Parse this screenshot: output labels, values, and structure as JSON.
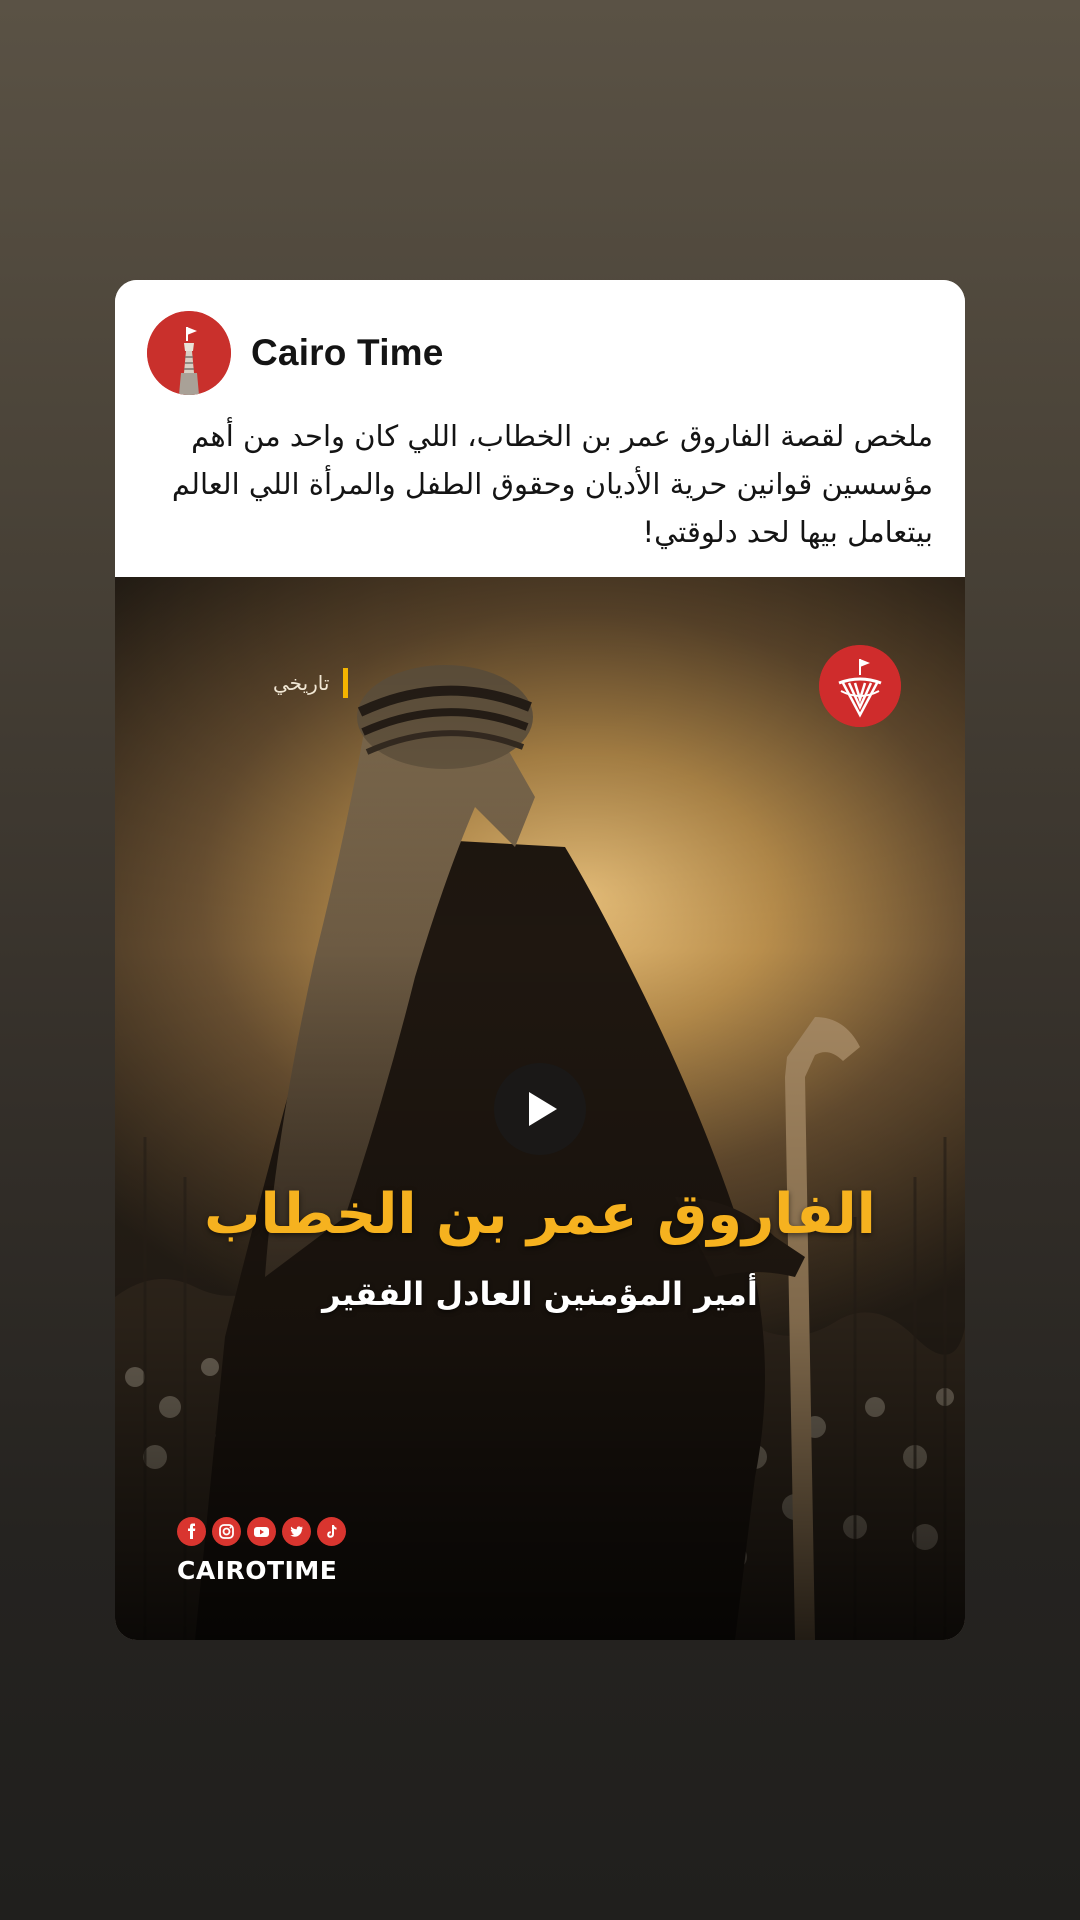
{
  "post": {
    "page_name": "Cairo Time",
    "avatar_icon": "cairo-tower-logo-icon",
    "caption": "ملخص لقصة الفاروق عمر بن الخطاب، اللي كان واحد من أهم مؤسسين قوانين حرية الأديان وحقوق الطفل والمرأة اللي العالم بيتعامل بيها لحد دلوقتي!"
  },
  "media": {
    "category": "تاريخي",
    "headline": "الفاروق عمر بن الخطاب",
    "subheadline": "أمير المؤمنين العادل الفقير",
    "watermark": "CAIROTIME",
    "play_icon": "play-icon",
    "social_icons": [
      "facebook-icon",
      "instagram-icon",
      "youtube-icon",
      "twitter-icon",
      "tiktok-icon"
    ]
  },
  "colors": {
    "brand_red": "#d9352f",
    "headline_gold": "#f6b21f",
    "category_bar": "#f4b400"
  }
}
